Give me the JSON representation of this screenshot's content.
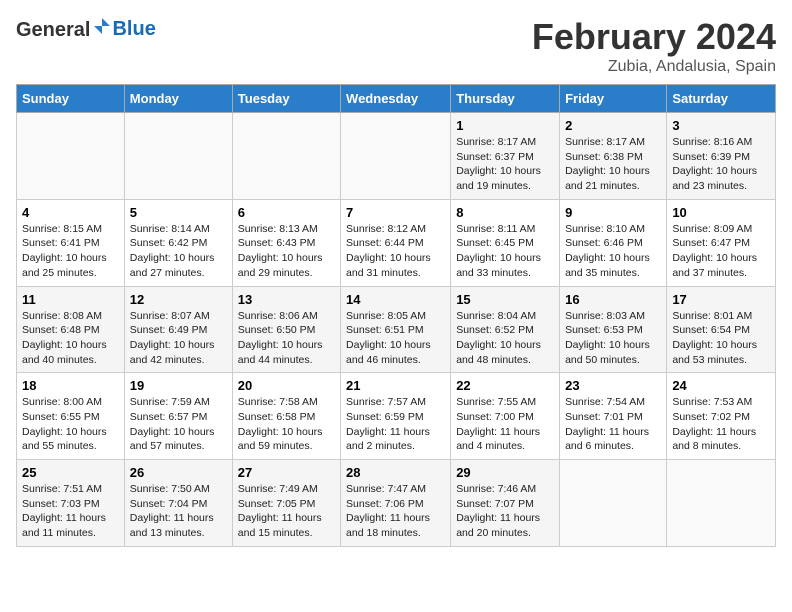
{
  "header": {
    "logo_general": "General",
    "logo_blue": "Blue",
    "month_title": "February 2024",
    "location": "Zubia, Andalusia, Spain"
  },
  "days_of_week": [
    "Sunday",
    "Monday",
    "Tuesday",
    "Wednesday",
    "Thursday",
    "Friday",
    "Saturday"
  ],
  "weeks": [
    [
      {
        "day": "",
        "info": ""
      },
      {
        "day": "",
        "info": ""
      },
      {
        "day": "",
        "info": ""
      },
      {
        "day": "",
        "info": ""
      },
      {
        "day": "1",
        "info": "Sunrise: 8:17 AM\nSunset: 6:37 PM\nDaylight: 10 hours and 19 minutes."
      },
      {
        "day": "2",
        "info": "Sunrise: 8:17 AM\nSunset: 6:38 PM\nDaylight: 10 hours and 21 minutes."
      },
      {
        "day": "3",
        "info": "Sunrise: 8:16 AM\nSunset: 6:39 PM\nDaylight: 10 hours and 23 minutes."
      }
    ],
    [
      {
        "day": "4",
        "info": "Sunrise: 8:15 AM\nSunset: 6:41 PM\nDaylight: 10 hours and 25 minutes."
      },
      {
        "day": "5",
        "info": "Sunrise: 8:14 AM\nSunset: 6:42 PM\nDaylight: 10 hours and 27 minutes."
      },
      {
        "day": "6",
        "info": "Sunrise: 8:13 AM\nSunset: 6:43 PM\nDaylight: 10 hours and 29 minutes."
      },
      {
        "day": "7",
        "info": "Sunrise: 8:12 AM\nSunset: 6:44 PM\nDaylight: 10 hours and 31 minutes."
      },
      {
        "day": "8",
        "info": "Sunrise: 8:11 AM\nSunset: 6:45 PM\nDaylight: 10 hours and 33 minutes."
      },
      {
        "day": "9",
        "info": "Sunrise: 8:10 AM\nSunset: 6:46 PM\nDaylight: 10 hours and 35 minutes."
      },
      {
        "day": "10",
        "info": "Sunrise: 8:09 AM\nSunset: 6:47 PM\nDaylight: 10 hours and 37 minutes."
      }
    ],
    [
      {
        "day": "11",
        "info": "Sunrise: 8:08 AM\nSunset: 6:48 PM\nDaylight: 10 hours and 40 minutes."
      },
      {
        "day": "12",
        "info": "Sunrise: 8:07 AM\nSunset: 6:49 PM\nDaylight: 10 hours and 42 minutes."
      },
      {
        "day": "13",
        "info": "Sunrise: 8:06 AM\nSunset: 6:50 PM\nDaylight: 10 hours and 44 minutes."
      },
      {
        "day": "14",
        "info": "Sunrise: 8:05 AM\nSunset: 6:51 PM\nDaylight: 10 hours and 46 minutes."
      },
      {
        "day": "15",
        "info": "Sunrise: 8:04 AM\nSunset: 6:52 PM\nDaylight: 10 hours and 48 minutes."
      },
      {
        "day": "16",
        "info": "Sunrise: 8:03 AM\nSunset: 6:53 PM\nDaylight: 10 hours and 50 minutes."
      },
      {
        "day": "17",
        "info": "Sunrise: 8:01 AM\nSunset: 6:54 PM\nDaylight: 10 hours and 53 minutes."
      }
    ],
    [
      {
        "day": "18",
        "info": "Sunrise: 8:00 AM\nSunset: 6:55 PM\nDaylight: 10 hours and 55 minutes."
      },
      {
        "day": "19",
        "info": "Sunrise: 7:59 AM\nSunset: 6:57 PM\nDaylight: 10 hours and 57 minutes."
      },
      {
        "day": "20",
        "info": "Sunrise: 7:58 AM\nSunset: 6:58 PM\nDaylight: 10 hours and 59 minutes."
      },
      {
        "day": "21",
        "info": "Sunrise: 7:57 AM\nSunset: 6:59 PM\nDaylight: 11 hours and 2 minutes."
      },
      {
        "day": "22",
        "info": "Sunrise: 7:55 AM\nSunset: 7:00 PM\nDaylight: 11 hours and 4 minutes."
      },
      {
        "day": "23",
        "info": "Sunrise: 7:54 AM\nSunset: 7:01 PM\nDaylight: 11 hours and 6 minutes."
      },
      {
        "day": "24",
        "info": "Sunrise: 7:53 AM\nSunset: 7:02 PM\nDaylight: 11 hours and 8 minutes."
      }
    ],
    [
      {
        "day": "25",
        "info": "Sunrise: 7:51 AM\nSunset: 7:03 PM\nDaylight: 11 hours and 11 minutes."
      },
      {
        "day": "26",
        "info": "Sunrise: 7:50 AM\nSunset: 7:04 PM\nDaylight: 11 hours and 13 minutes."
      },
      {
        "day": "27",
        "info": "Sunrise: 7:49 AM\nSunset: 7:05 PM\nDaylight: 11 hours and 15 minutes."
      },
      {
        "day": "28",
        "info": "Sunrise: 7:47 AM\nSunset: 7:06 PM\nDaylight: 11 hours and 18 minutes."
      },
      {
        "day": "29",
        "info": "Sunrise: 7:46 AM\nSunset: 7:07 PM\nDaylight: 11 hours and 20 minutes."
      },
      {
        "day": "",
        "info": ""
      },
      {
        "day": "",
        "info": ""
      }
    ]
  ]
}
